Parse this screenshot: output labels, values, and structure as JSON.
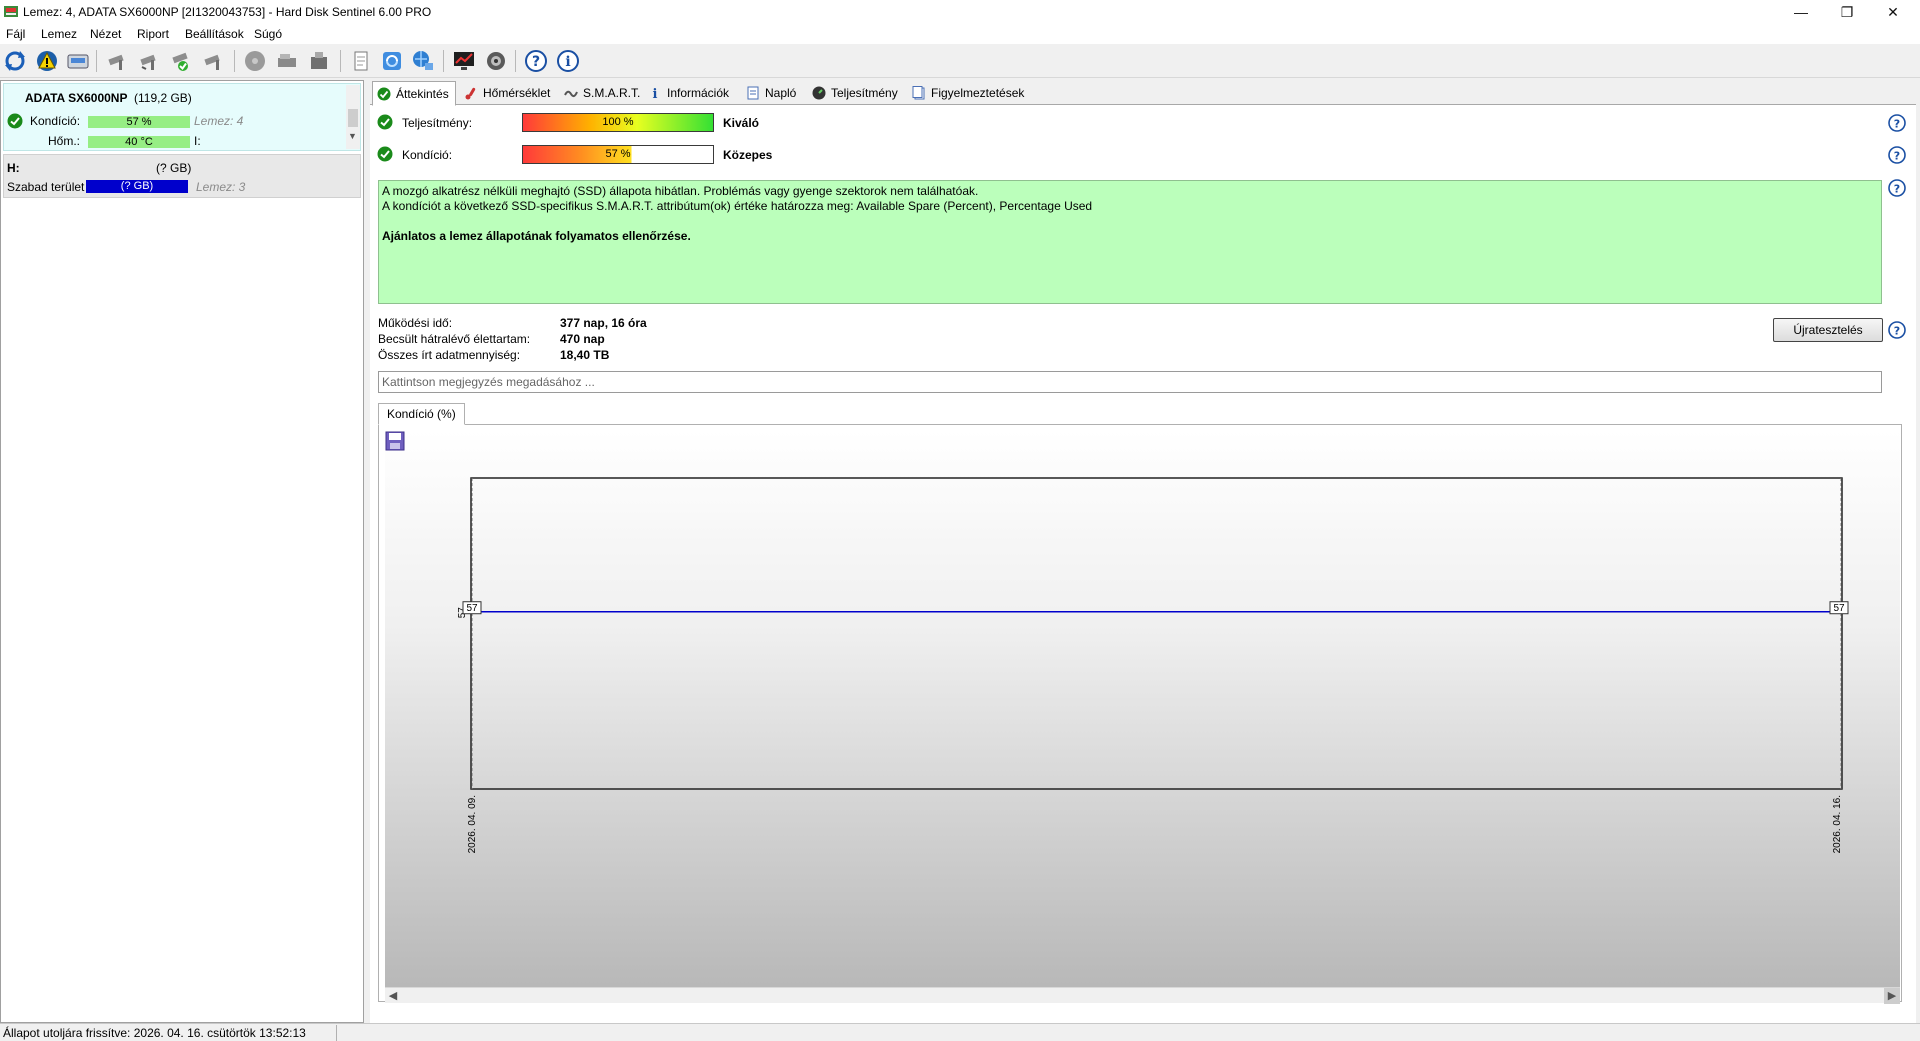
{
  "window": {
    "title": "Lemez: 4, ADATA SX6000NP [2I1320043753]  -  Hard Disk Sentinel 6.00 PRO",
    "minimize_label": "—",
    "restore_label": "❐",
    "close_label": "✕"
  },
  "menu": [
    "Fájl",
    "Lemez",
    "Nézet",
    "Riport",
    "Beállítások",
    "Súgó"
  ],
  "toolbar_icons": [
    "refresh-icon",
    "warning-icon",
    "disk-icon",
    "tool-1-icon",
    "tool-2-icon",
    "tool-3-icon",
    "tool-4-icon",
    "disk-gray-icon",
    "drive-2-icon",
    "drive-3-icon",
    "report-icon",
    "sync-icon",
    "network-icon",
    "monitor-icon",
    "speaker-icon",
    "help-icon",
    "about-icon"
  ],
  "left_panel": {
    "disk": {
      "name": "ADATA SX6000NP",
      "size": "(119,2 GB)",
      "health_label": "Kondíció:",
      "health_value": "57 %",
      "health_percent": 57,
      "disk_num": "Lemez: 4",
      "temp_label": "Hőm.:",
      "temp_value": "40 °C",
      "temp_percent": 55,
      "drive_letter": "I:"
    },
    "volume": {
      "letter": "H:",
      "size": "(? GB)",
      "free_label": "Szabad terület",
      "free_value": "(? GB)",
      "disk_num": "Lemez: 3"
    }
  },
  "tabs": [
    {
      "label": "Áttekintés",
      "icon": "check-icon",
      "active": true
    },
    {
      "label": "Hőmérséklet",
      "icon": "thermometer-icon"
    },
    {
      "label": "S.M.A.R.T.",
      "icon": "smart-icon"
    },
    {
      "label": "Információk",
      "icon": "info-icon"
    },
    {
      "label": "Napló",
      "icon": "log-icon"
    },
    {
      "label": "Teljesítmény",
      "icon": "performance-icon"
    },
    {
      "label": "Figyelmeztetések",
      "icon": "alerts-icon"
    }
  ],
  "overview": {
    "performance_label": "Teljesítmény:",
    "performance_value": "100 %",
    "performance_percent": 100,
    "performance_rating": "Kiváló",
    "health_label": "Kondíció:",
    "health_value": "57 %",
    "health_percent": 57,
    "health_rating": "Közepes",
    "message_line1": "A mozgó alkatrész nélküli meghajtó (SSD) állapota hibátlan. Problémás vagy gyenge szektorok nem találhatóak.",
    "message_line2": "A kondíciót a következő SSD-specifikus S.M.A.R.T. attribútum(ok) értéke határozza meg:  Available Spare (Percent), Percentage Used",
    "message_line3": "Ajánlatos a lemez állapotának folyamatos ellenőrzése.",
    "uptime_label": "Működési idő:",
    "uptime_value": "377 nap, 16 óra",
    "remaining_label": "Becsült hátralévő élettartam:",
    "remaining_value": "470 nap",
    "written_label": "Összes írt adatmennyiség:",
    "written_value": "18,40 TB",
    "retest_label": "Újratesztelés",
    "note_placeholder": "Kattintson megjegyzés megadásához ..."
  },
  "chart_tab_label": "Kondíció  (%)",
  "chart_data": {
    "type": "line",
    "x": [
      "2026. 04. 09.",
      "2026. 04. 16."
    ],
    "series": [
      {
        "values": [
          57,
          57
        ]
      }
    ],
    "y_tick": "57",
    "start_label": "57",
    "end_label": "57",
    "ylim": [
      0,
      100
    ],
    "line_color": "#0000cc",
    "grid": false
  },
  "status": {
    "text": "Állapot utoljára frissítve: 2026. 04. 16. csütörtök 13:52:13"
  },
  "colors": {
    "green_bar": "#96ee84",
    "message_bg": "#bbffbb",
    "disk_card_bg": "#e6fcfc",
    "free_bar": "#0000cc"
  }
}
